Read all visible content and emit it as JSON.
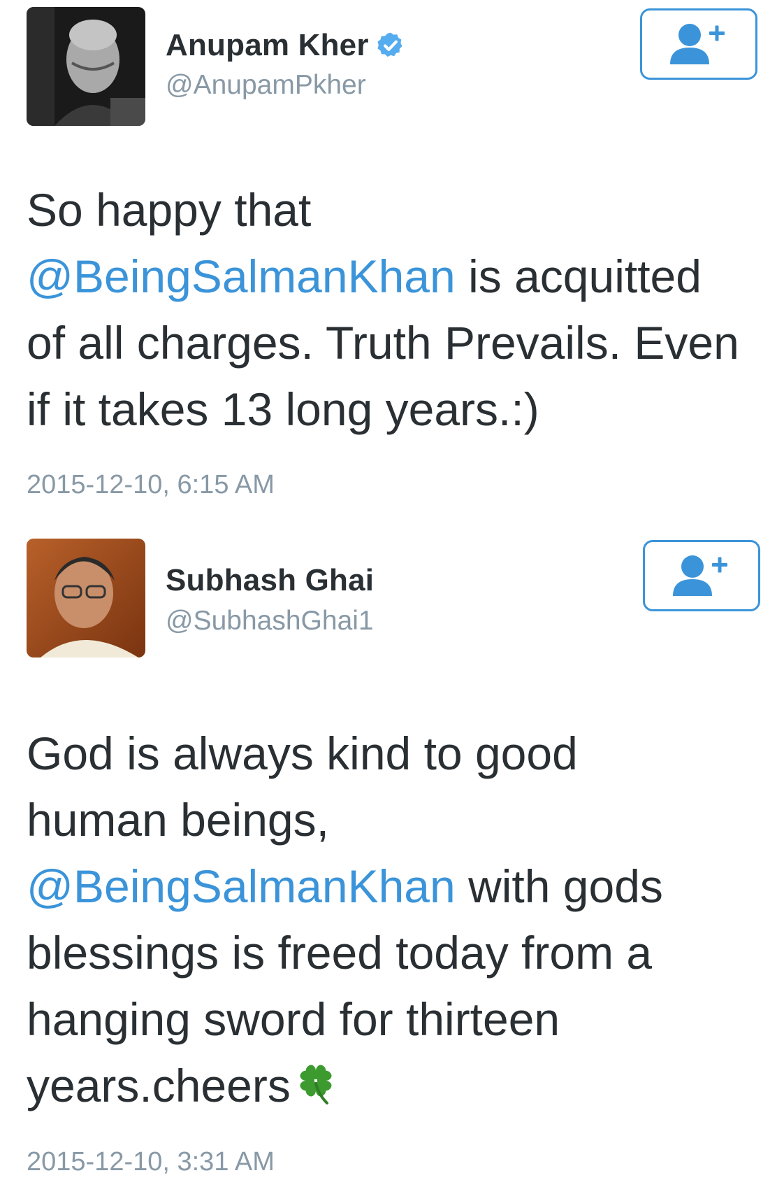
{
  "tweets": [
    {
      "author": {
        "display_name": "Anupam Kher",
        "handle": "@AnupamPkher",
        "verified": true,
        "avatar_icon": "avatar-photo-grayscale"
      },
      "follow_icon": "follow-user-icon",
      "text_lines": [
        {
          "before": "So happy that",
          "mention": "",
          "after": ""
        },
        {
          "before": "",
          "mention": "@BeingSalmanKhan",
          "after": " is acquitted"
        },
        {
          "before": "of all charges. Truth Prevails. Even",
          "mention": "",
          "after": ""
        },
        {
          "before": "if it takes 13 long years.:)",
          "mention": "",
          "after": ""
        }
      ],
      "timestamp": "2015-12-10, 6:15 AM"
    },
    {
      "author": {
        "display_name": "Subhash Ghai",
        "handle": "@SubhashGhai1",
        "verified": false,
        "avatar_icon": "avatar-photo-color"
      },
      "follow_icon": "follow-user-icon",
      "text_lines": [
        {
          "before": "God is always kind to good",
          "mention": "",
          "after": ""
        },
        {
          "before": "human beings,",
          "mention": "",
          "after": ""
        },
        {
          "before": "",
          "mention": "@BeingSalmanKhan",
          "after": " with gods"
        },
        {
          "before": "blessings is freed today from a",
          "mention": "",
          "after": ""
        },
        {
          "before": "hanging sword for thirteen",
          "mention": "",
          "after": ""
        },
        {
          "before": "years.cheers",
          "mention": "",
          "after": "",
          "emoji": "four-leaf-clover-icon"
        }
      ],
      "timestamp": "2015-12-10, 3:31 AM"
    }
  ],
  "colors": {
    "link": "#3b94d9",
    "text": "#292f33",
    "muted": "#8899a6",
    "verified": "#55acee",
    "clover": "#3c9a2f"
  }
}
